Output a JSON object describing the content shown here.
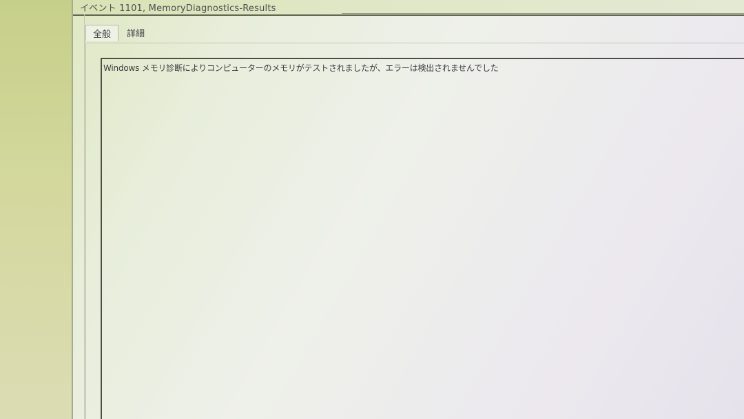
{
  "window": {
    "title": "イベント 1101, MemoryDiagnostics-Results"
  },
  "tabs": [
    {
      "label": "全般",
      "active": true
    },
    {
      "label": "詳細",
      "active": false
    }
  ],
  "general_tab": {
    "message": "Windows メモリ診断によりコンピューターのメモリがテストされましたが、エラーは検出されませんでした"
  }
}
